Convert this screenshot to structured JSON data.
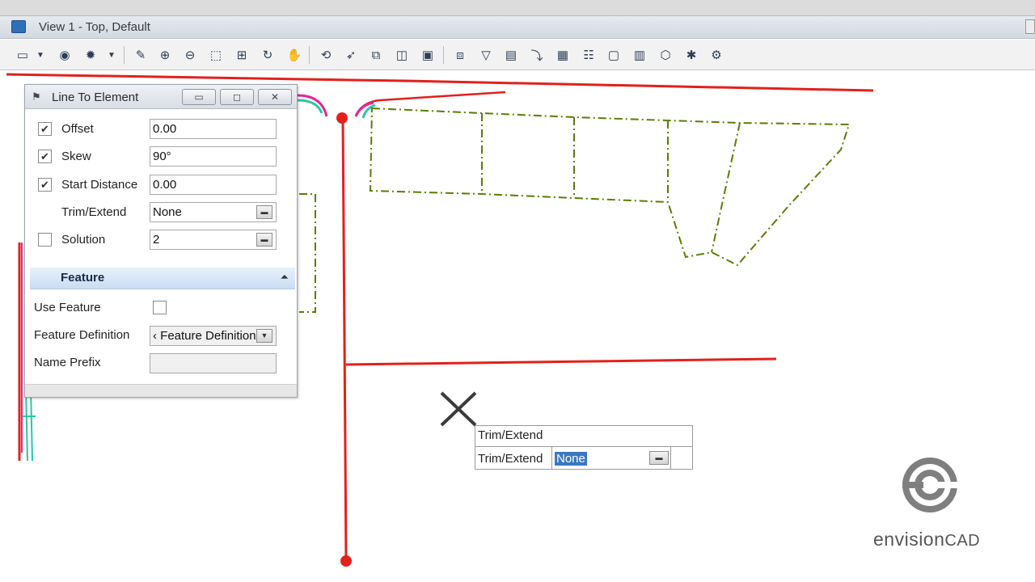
{
  "window": {
    "title": "View 1 - Top, Default"
  },
  "toolbar": {
    "icons": [
      "view-settings-icon",
      "dropdown-icon",
      "view-display-icon",
      "sun-icon",
      "dropdown-icon",
      "update-view-icon",
      "zoom-in-icon",
      "zoom-out-icon",
      "window-area-icon",
      "fit-view-icon",
      "rotate-view-icon",
      "pan-view-icon",
      "view-previous-icon",
      "select-element-icon",
      "copy-view-icon",
      "camera-icon",
      "view-area-icon",
      "clip-volume-icon",
      "clip-mask-icon",
      "display-style-icon",
      "render-icon",
      "level-icon",
      "saved-view-icon",
      "frame-icon",
      "books-icon",
      "cube-icon",
      "tools-icon",
      "settings-icon"
    ]
  },
  "dialog": {
    "title": "Line To Element",
    "offset": {
      "label": "Offset",
      "value": "0.00",
      "checked": true
    },
    "skew": {
      "label": "Skew",
      "value": "90°",
      "checked": true
    },
    "start_distance": {
      "label": "Start Distance",
      "value": "0.00",
      "checked": true
    },
    "trim_extend": {
      "label": "Trim/Extend",
      "value": "None"
    },
    "solution": {
      "label": "Solution",
      "value": "2",
      "checked": false
    },
    "feature_section": {
      "title": "Feature"
    },
    "use_feature": {
      "label": "Use Feature",
      "checked": false
    },
    "feature_definition": {
      "label": "Feature Definition",
      "value": "‹ Feature Definition"
    },
    "name_prefix": {
      "label": "Name Prefix",
      "value": ""
    }
  },
  "tooltip": {
    "header": "Trim/Extend",
    "label": "Trim/Extend",
    "value": "None"
  },
  "logo": {
    "text_regular": "envision",
    "text_caps": "CAD"
  },
  "colors": {
    "red_line": "#e3201b",
    "green_dash": "#5a7d00",
    "magenta": "#e0269a",
    "cyan": "#28c8a0",
    "selection": "#3a77c6"
  }
}
